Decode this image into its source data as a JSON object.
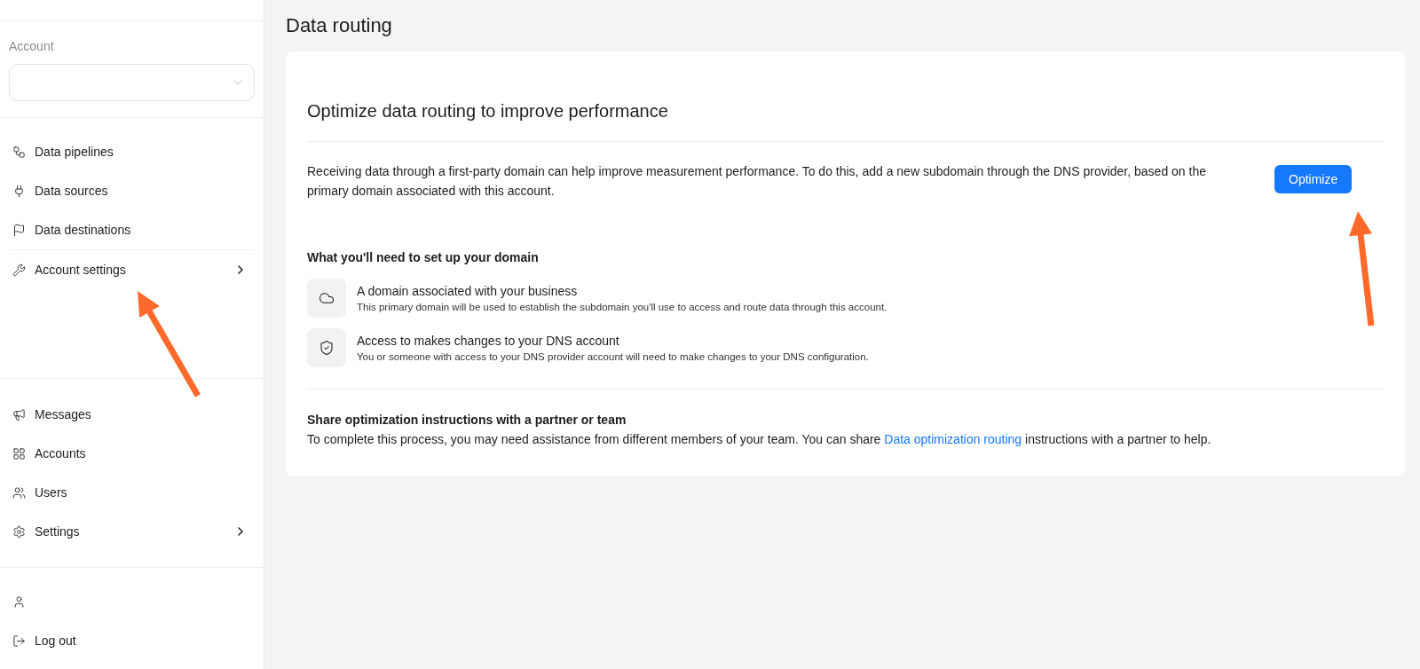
{
  "sidebar": {
    "account_label": "Account",
    "groups": [
      {
        "items": [
          {
            "label": "Data pipelines",
            "has_submenu": false
          },
          {
            "label": "Data sources",
            "has_submenu": false
          },
          {
            "label": "Data destinations",
            "has_submenu": false
          }
        ]
      },
      {
        "items": [
          {
            "label": "Account settings",
            "has_submenu": true
          }
        ]
      },
      {
        "items": [
          {
            "label": "Messages",
            "has_submenu": false
          },
          {
            "label": "Accounts",
            "has_submenu": false
          },
          {
            "label": "Users",
            "has_submenu": false
          },
          {
            "label": "Settings",
            "has_submenu": true
          }
        ]
      },
      {
        "items": [
          {
            "has_submenu": false
          },
          {
            "label": "Log out",
            "has_submenu": false
          }
        ]
      }
    ]
  },
  "page_title": "Data routing",
  "card": {
    "heading": "Optimize data routing to improve performance",
    "description": "Receiving data through a first-party domain can help improve measurement performance. To do this, add a new subdomain through the DNS provider, based on the primary domain associated with this account.",
    "button": "Optimize",
    "requirements_heading": "What you'll need to set up your domain",
    "requirements": [
      {
        "title": "A domain associated with your business",
        "text": "This primary domain will be used to establish the subdomain you'll use to access and route data through this account."
      },
      {
        "title": "Access to makes changes to your DNS account",
        "text": "You or someone with access to your DNS provider account will need to make changes to your DNS configuration."
      }
    ],
    "share_heading": "Share optimization instructions with a partner or team",
    "share_text_before": "To complete this process, you may need assistance from different members of your team. You can share",
    "share_link": "Data optimization routing",
    "share_text_after": "instructions with a partner to help."
  }
}
